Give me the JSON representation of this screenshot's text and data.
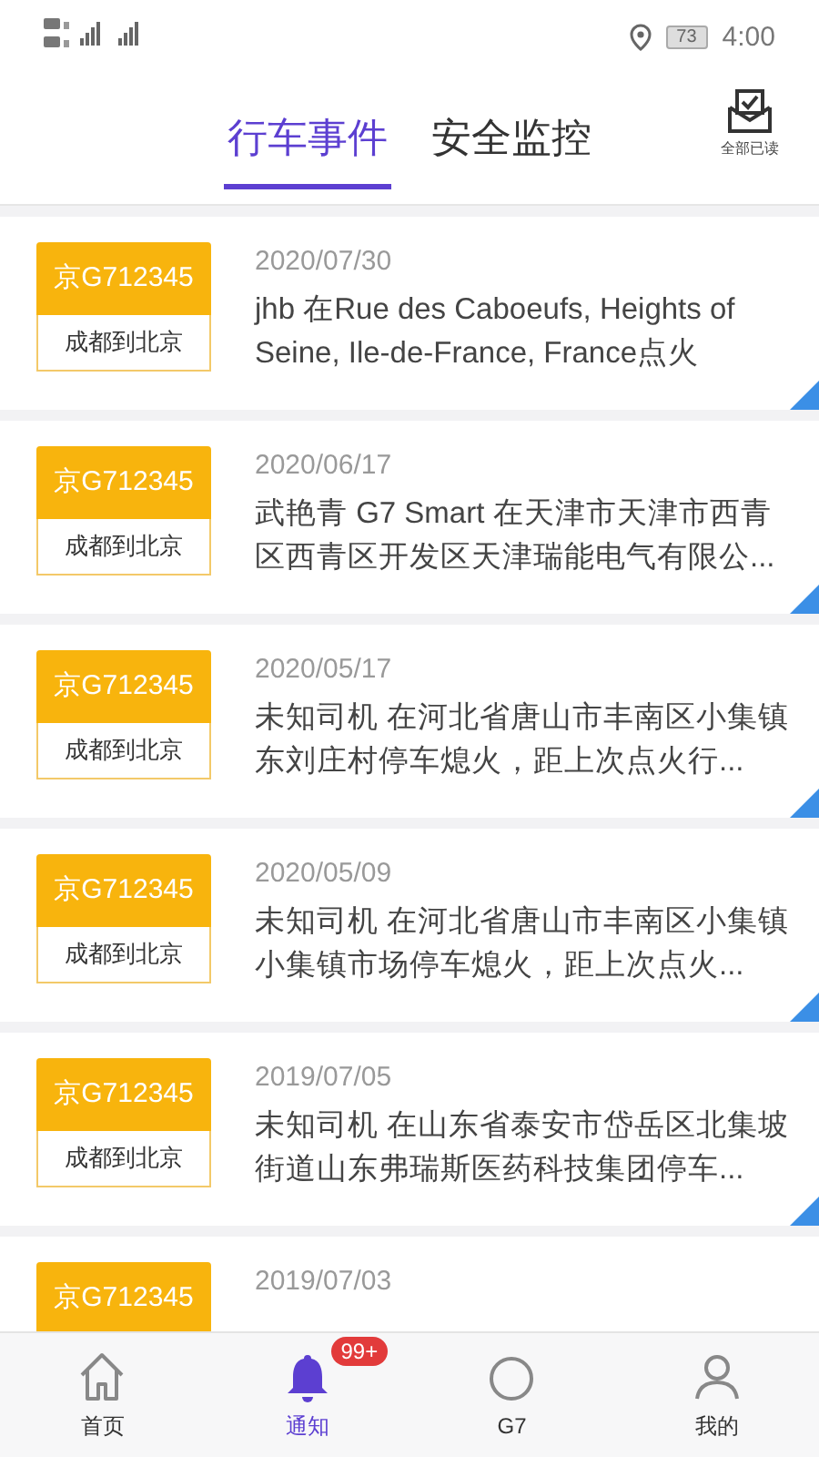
{
  "status_bar": {
    "battery": "73",
    "time": "4:00"
  },
  "tabs": [
    {
      "label": "行车事件",
      "selected": true
    },
    {
      "label": "安全监控",
      "selected": false
    }
  ],
  "mark_all_read": {
    "label": "全部已读"
  },
  "events": [
    {
      "plate": "京G712345",
      "route": "成都到北京",
      "date": "2020/07/30",
      "text": "jhb 在Rue des Caboeufs, Heights of Seine, Ile-de-France, France点火"
    },
    {
      "plate": "京G712345",
      "route": "成都到北京",
      "date": "2020/06/17",
      "text": "武艳青 G7 Smart 在天津市天津市西青区西青区开发区天津瑞能电气有限公..."
    },
    {
      "plate": "京G712345",
      "route": "成都到北京",
      "date": "2020/05/17",
      "text": "未知司机 在河北省唐山市丰南区小集镇东刘庄村停车熄火，距上次点火行..."
    },
    {
      "plate": "京G712345",
      "route": "成都到北京",
      "date": "2020/05/09",
      "text": "未知司机 在河北省唐山市丰南区小集镇小集镇市场停车熄火，距上次点火..."
    },
    {
      "plate": "京G712345",
      "route": "成都到北京",
      "date": "2019/07/05",
      "text": "未知司机 在山东省泰安市岱岳区北集坡街道山东弗瑞斯医药科技集团停车..."
    },
    {
      "plate": "京G712345",
      "date": "2019/07/03"
    }
  ],
  "bottom_nav": [
    {
      "kind": "home",
      "label": "首页",
      "selected": false
    },
    {
      "kind": "bell",
      "label": "通知",
      "selected": true,
      "badge": "99+"
    },
    {
      "kind": "circle",
      "label": "G7",
      "selected": false
    },
    {
      "kind": "person",
      "label": "我的",
      "selected": false
    }
  ]
}
